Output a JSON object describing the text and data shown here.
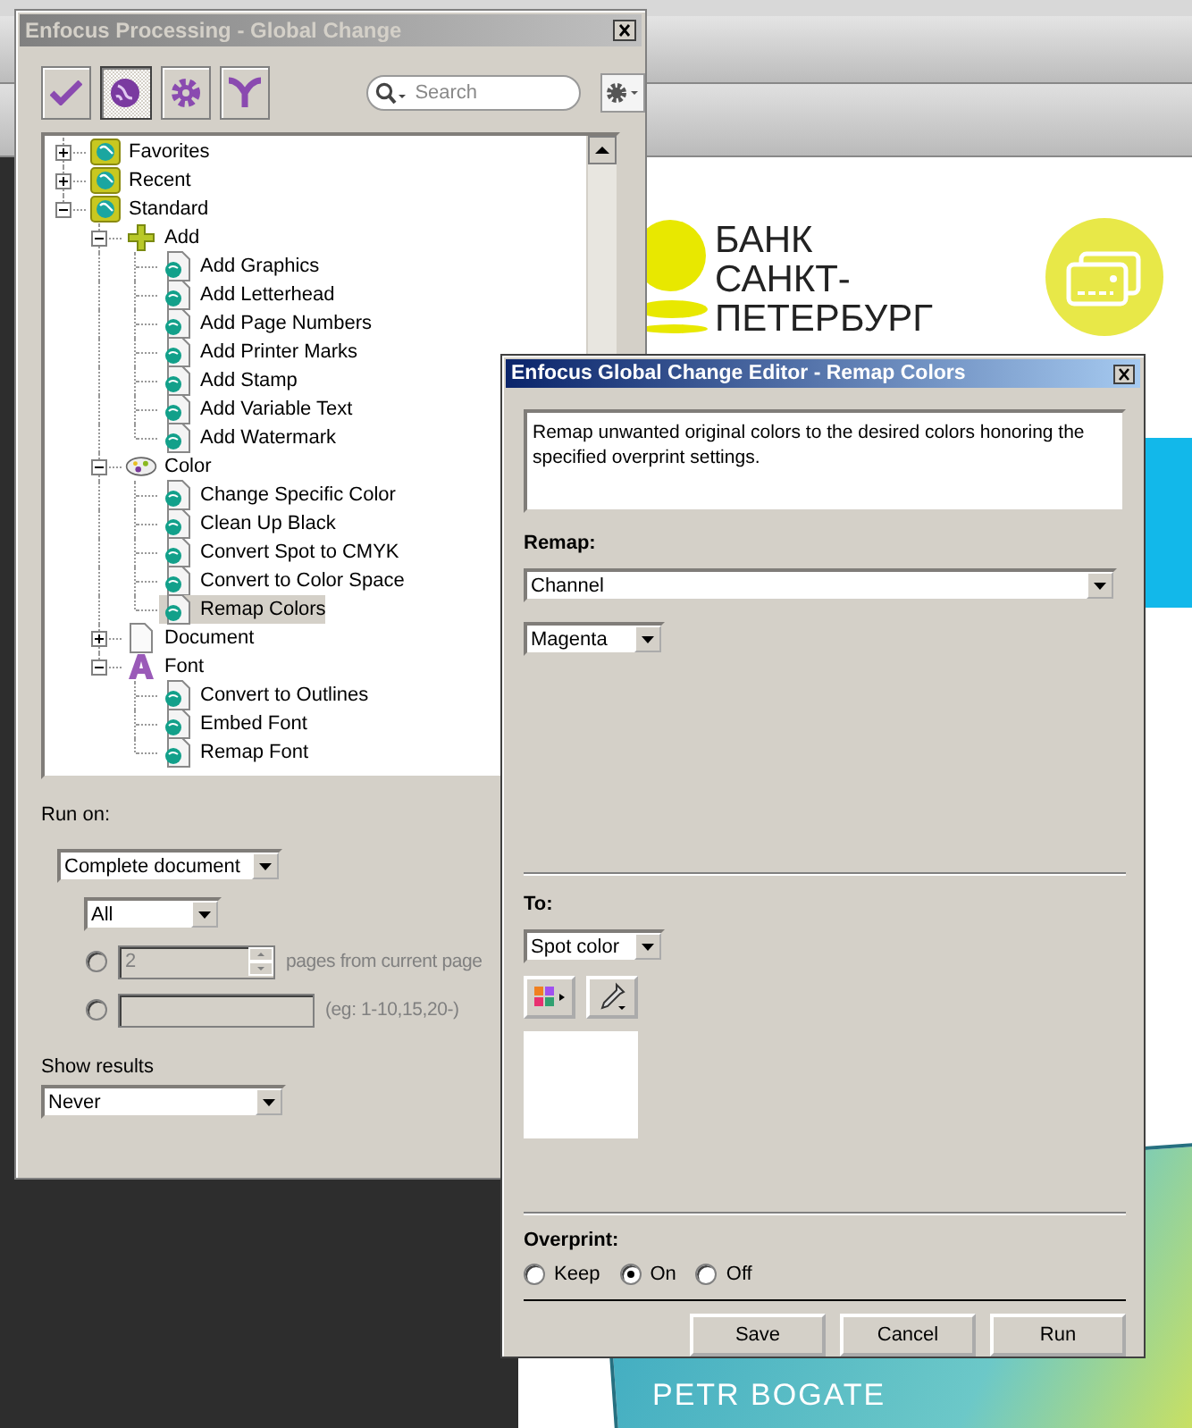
{
  "background": {
    "bank_logo": [
      "БАНК",
      "САНКТ-",
      "ПЕТЕРБУРГ"
    ],
    "card_name": "PETR BOGATE"
  },
  "processing": {
    "title": "Enfocus Processing - Global Change",
    "toolbar": [
      {
        "kind": "check",
        "selected": false
      },
      {
        "kind": "globe",
        "selected": true
      },
      {
        "kind": "gear",
        "selected": false
      },
      {
        "kind": "funnel",
        "selected": false
      }
    ],
    "search": {
      "placeholder": "Search"
    },
    "tree": [
      {
        "label": "Favorites",
        "kind": "group",
        "expanded": false,
        "selected": false
      },
      {
        "label": "Recent",
        "kind": "group",
        "expanded": false,
        "selected": false
      },
      {
        "label": "Standard",
        "kind": "group",
        "expanded": true,
        "selected": false,
        "children": [
          {
            "label": "Add",
            "kind": "add",
            "expanded": true,
            "selected": false,
            "children": [
              {
                "label": "Add Graphics",
                "kind": "action",
                "selected": false
              },
              {
                "label": "Add Letterhead",
                "kind": "action",
                "selected": false
              },
              {
                "label": "Add Page Numbers",
                "kind": "action",
                "selected": false
              },
              {
                "label": "Add Printer Marks",
                "kind": "action",
                "selected": false
              },
              {
                "label": "Add Stamp",
                "kind": "action",
                "selected": false
              },
              {
                "label": "Add Variable Text",
                "kind": "action",
                "selected": false
              },
              {
                "label": "Add Watermark",
                "kind": "action",
                "selected": false
              }
            ]
          },
          {
            "label": "Color",
            "kind": "color",
            "expanded": true,
            "selected": false,
            "children": [
              {
                "label": "Change Specific Color",
                "kind": "action",
                "selected": false
              },
              {
                "label": "Clean Up Black",
                "kind": "action",
                "selected": false
              },
              {
                "label": "Convert Spot to CMYK",
                "kind": "action",
                "selected": false
              },
              {
                "label": "Convert to Color Space",
                "kind": "action",
                "selected": false
              },
              {
                "label": "Remap Colors",
                "kind": "action",
                "selected": true
              }
            ]
          },
          {
            "label": "Document",
            "kind": "document",
            "expanded": false,
            "selected": false
          },
          {
            "label": "Font",
            "kind": "font",
            "expanded": true,
            "selected": false,
            "children": [
              {
                "label": "Convert to Outlines",
                "kind": "action",
                "selected": false
              },
              {
                "label": "Embed Font",
                "kind": "action",
                "selected": false
              },
              {
                "label": "Remap Font",
                "kind": "action",
                "selected": false
              }
            ]
          }
        ]
      }
    ],
    "run_on": {
      "label": "Run on:",
      "scope": "Complete document",
      "pages": "All",
      "ranges": [
        {
          "kind": "spin",
          "value": "2",
          "hint": "pages from current page",
          "selected": false,
          "disabled": true
        },
        {
          "kind": "text",
          "hint": "(eg: 1-10,15,20-)",
          "selected": false,
          "disabled": true
        }
      ]
    },
    "show_results": {
      "label": "Show results",
      "value": "Never"
    }
  },
  "editor": {
    "title": "Enfocus Global Change Editor - Remap Colors",
    "description": "Remap unwanted original colors to the desired colors honoring the specified overprint settings.",
    "remap": {
      "label": "Remap:",
      "mode": "Channel",
      "channel": "Magenta"
    },
    "to": {
      "label": "To:",
      "mode": "Spot color"
    },
    "overprint": {
      "label": "Overprint:",
      "options": [
        {
          "label": "Keep",
          "selected": false
        },
        {
          "label": "On",
          "selected": true
        },
        {
          "label": "Off",
          "selected": false
        }
      ]
    },
    "buttons": [
      "Save",
      "Cancel",
      "Run"
    ]
  }
}
